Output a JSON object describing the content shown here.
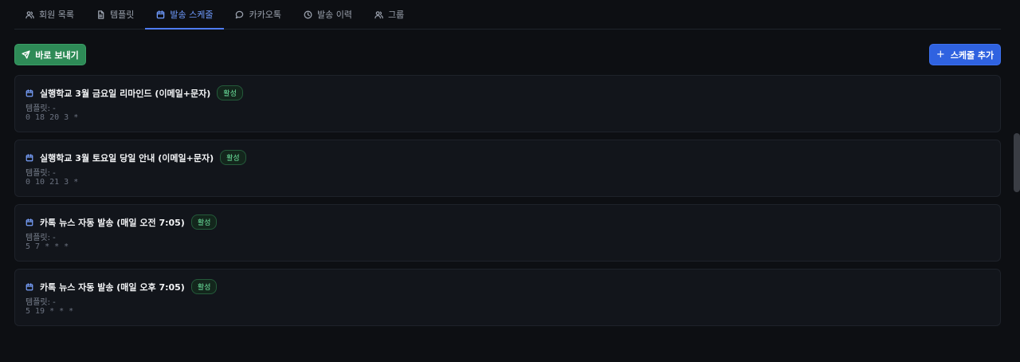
{
  "tabs": [
    {
      "label": "회원 목록",
      "icon": "users-icon",
      "active": false
    },
    {
      "label": "템플릿",
      "icon": "file-icon",
      "active": false
    },
    {
      "label": "발송 스케줄",
      "icon": "calendar-icon",
      "active": true
    },
    {
      "label": "카카오톡",
      "icon": "chat-bubble-icon",
      "active": false
    },
    {
      "label": "발송 이력",
      "icon": "clock-icon",
      "active": false
    },
    {
      "label": "그룹",
      "icon": "users-icon",
      "active": false
    }
  ],
  "toolbar": {
    "send_now_label": "바로 보내기",
    "add_schedule_label": "스케줄 추가"
  },
  "schedules": [
    {
      "title": "실행학교 3월 금요일 리마인드 (이메일+문자)",
      "status": "활성",
      "template": "템플릿: -",
      "cron": "0 18 20 3 *"
    },
    {
      "title": "실행학교 3월 토요일 당일 안내 (이메일+문자)",
      "status": "활성",
      "template": "템플릿: -",
      "cron": "0 10 21 3 *"
    },
    {
      "title": "카톡 뉴스 자동 발송 (매일 오전 7:05)",
      "status": "활성",
      "template": "템플릿: -",
      "cron": "5 7 * * *"
    },
    {
      "title": "카톡 뉴스 자동 발송 (매일 오후 7:05)",
      "status": "활성",
      "template": "템플릿: -",
      "cron": "5 19 * * *"
    }
  ],
  "colors": {
    "accent": "#4f7cf5",
    "send_button": "#2e8b57",
    "add_button": "#2f62e0",
    "active_badge": "#6ee7a0"
  }
}
